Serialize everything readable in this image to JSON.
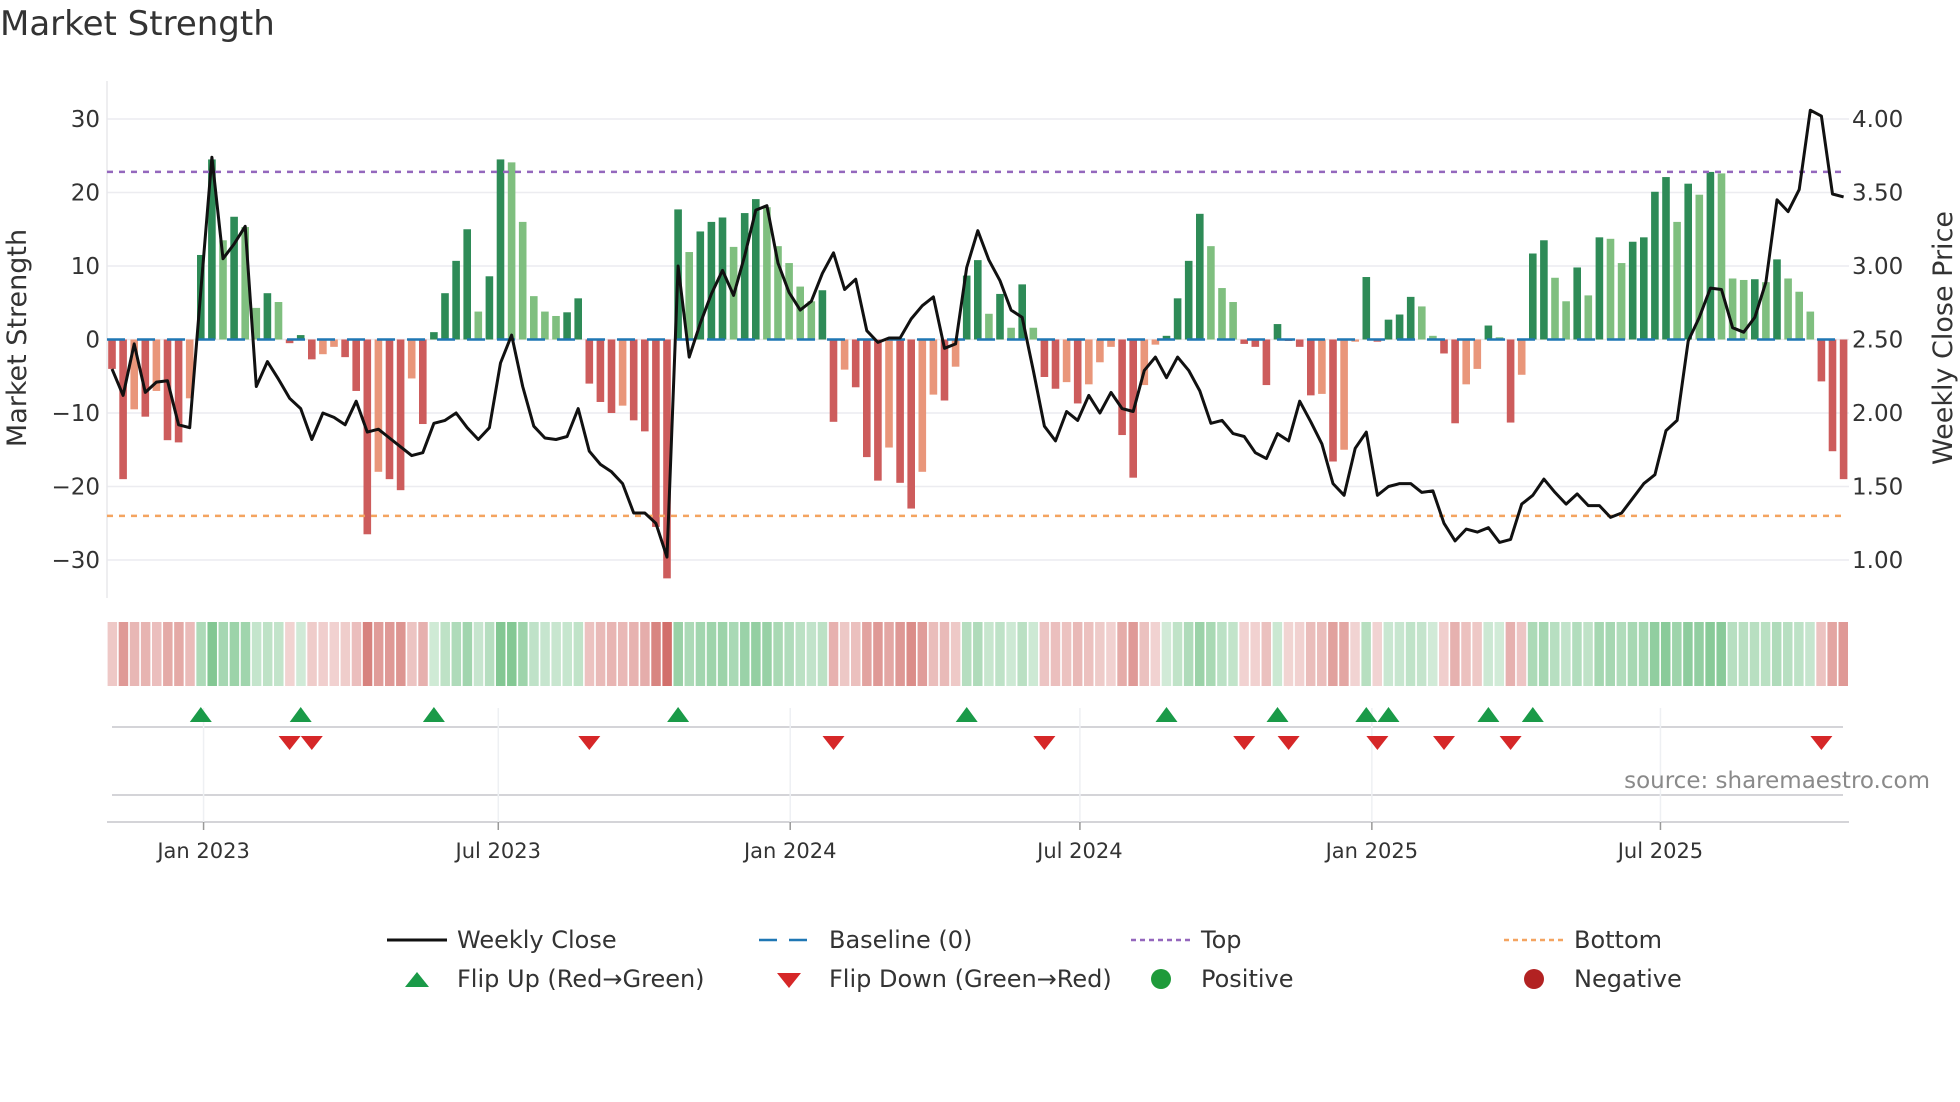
{
  "chart_data": {
    "type": "bar+line",
    "title": "Market Strength",
    "ylabel": "Market Strength",
    "ylabel_right": "Weekly Close Price",
    "ylim": [
      -35,
      35
    ],
    "ylim_right": [
      0.75,
      4.25
    ],
    "yticks": [
      "30",
      "20",
      "10",
      "0",
      "−10",
      "−20",
      "−30"
    ],
    "ytick_values": [
      30,
      20,
      10,
      0,
      -10,
      -20,
      -30
    ],
    "yticks_right": [
      "4.00",
      "3.50",
      "3.00",
      "2.50",
      "2.00",
      "1.50",
      "1.00"
    ],
    "ytick_right_values": [
      4.0,
      3.5,
      3.0,
      2.5,
      2.0,
      1.5,
      1.0
    ],
    "xticks": [
      {
        "label": "Jan 2023",
        "week": 8.25
      },
      {
        "label": "Jul 2023",
        "week": 34.8
      },
      {
        "label": "Jan 2024",
        "week": 61.1
      },
      {
        "label": "Jul 2024",
        "week": 87.2
      },
      {
        "label": "Jan 2025",
        "week": 113.5
      },
      {
        "label": "Jul 2025",
        "week": 139.5
      }
    ],
    "top_level": 22.8,
    "bottom_level": -24,
    "baseline": 0,
    "strength": [
      -4,
      -19,
      -9.5,
      -10.5,
      -7,
      -13.7,
      -14,
      -8,
      11.5,
      24.5,
      13.5,
      16.7,
      15.3,
      4.3,
      6.3,
      5.1,
      -0.5,
      0.6,
      -2.7,
      -2,
      -1,
      -2.4,
      -7,
      -26.5,
      -18,
      -19,
      -20.5,
      -5.3,
      -11.5,
      1,
      6.3,
      10.7,
      15,
      3.8,
      8.6,
      24.5,
      24.1,
      16,
      5.9,
      3.8,
      3.2,
      3.7,
      5.6,
      -6,
      -8.5,
      -10,
      -9,
      -11,
      -12.5,
      -25.5,
      -32.5,
      17.7,
      11.9,
      14.7,
      16,
      16.6,
      12.6,
      17.2,
      19.1,
      18,
      12.7,
      10.4,
      7.2,
      5.2,
      6.7,
      -11.2,
      -4.1,
      -6.5,
      -16,
      -19.2,
      -14.7,
      -19.5,
      -23,
      -18,
      -7.5,
      -8.3,
      -3.7,
      8.7,
      10.8,
      3.5,
      6.2,
      1.6,
      7.5,
      1.6,
      -5.1,
      -6.7,
      -5.8,
      -8.7,
      -6.1,
      -3.1,
      -1,
      -13,
      -18.8,
      -6.2,
      -0.7,
      0.5,
      5.6,
      10.7,
      17.1,
      12.7,
      7,
      5.1,
      -0.6,
      -1,
      -6.2,
      2.1,
      -0.2,
      -1,
      -7.6,
      -7.4,
      -16.6,
      -15,
      -0.3,
      8.5,
      -0.3,
      2.7,
      3.4,
      5.8,
      4.5,
      0.5,
      -1.9,
      -11.4,
      -6.1,
      -4,
      1.9,
      0.3,
      -11.3,
      -4.8,
      11.7,
      13.5,
      8.4,
      5.2,
      9.8,
      6,
      13.9,
      13.7,
      10.4,
      13.3,
      13.9,
      20.1,
      22.1,
      16,
      21.2,
      19.7,
      22.8,
      22.6,
      8.3,
      8.1,
      8.2,
      7.8,
      10.9,
      8.3,
      6.5,
      3.8,
      -5.7,
      -15.2,
      -19
    ],
    "weekly_close": [
      2.3,
      2.12,
      2.47,
      2.14,
      2.21,
      2.22,
      1.92,
      1.9,
      2.83,
      3.74,
      3.05,
      3.15,
      3.27,
      2.18,
      2.35,
      2.23,
      2.1,
      2.03,
      1.82,
      2.0,
      1.97,
      1.92,
      2.08,
      1.87,
      1.89,
      1.83,
      1.77,
      1.71,
      1.73,
      1.93,
      1.95,
      2.0,
      1.9,
      1.82,
      1.9,
      2.34,
      2.53,
      2.18,
      1.91,
      1.83,
      1.82,
      1.84,
      2.03,
      1.74,
      1.65,
      1.6,
      1.52,
      1.32,
      1.32,
      1.25,
      1.02,
      3.0,
      2.38,
      2.61,
      2.81,
      2.97,
      2.8,
      3.07,
      3.38,
      3.41,
      3.02,
      2.82,
      2.7,
      2.76,
      2.95,
      3.09,
      2.84,
      2.91,
      2.56,
      2.48,
      2.51,
      2.51,
      2.64,
      2.73,
      2.79,
      2.44,
      2.47,
      2.99,
      3.24,
      3.04,
      2.9,
      2.7,
      2.65,
      2.29,
      1.91,
      1.81,
      2.01,
      1.95,
      2.12,
      2.0,
      2.14,
      2.03,
      2.01,
      2.29,
      2.38,
      2.24,
      2.38,
      2.29,
      2.15,
      1.93,
      1.95,
      1.86,
      1.84,
      1.73,
      1.69,
      1.86,
      1.81,
      2.08,
      1.94,
      1.79,
      1.52,
      1.44,
      1.76,
      1.87,
      1.44,
      1.5,
      1.52,
      1.52,
      1.46,
      1.47,
      1.25,
      1.13,
      1.21,
      1.19,
      1.22,
      1.12,
      1.14,
      1.38,
      1.44,
      1.55,
      1.46,
      1.38,
      1.45,
      1.37,
      1.37,
      1.29,
      1.32,
      1.42,
      1.52,
      1.58,
      1.88,
      1.95,
      2.49,
      2.65,
      2.85,
      2.84,
      2.58,
      2.55,
      2.65,
      2.89,
      3.45,
      3.37,
      3.52,
      4.06,
      4.02,
      3.49,
      3.47
    ],
    "grid": true,
    "legend_placement": "bottom-center",
    "legend": [
      {
        "label": "Weekly Close",
        "icon": "line-icon"
      },
      {
        "label": "Baseline (0)",
        "icon": "dashed-line-icon"
      },
      {
        "label": "Top",
        "icon": "dotted-line-icon"
      },
      {
        "label": "Bottom",
        "icon": "dotted-line-icon"
      },
      {
        "label": "Flip Up (Red→Green)",
        "icon": "triangle-up-icon"
      },
      {
        "label": "Flip Down (Green→Red)",
        "icon": "triangle-down-icon"
      },
      {
        "label": "Positive",
        "icon": "circle-icon"
      },
      {
        "label": "Negative",
        "icon": "circle-icon"
      }
    ],
    "source": "source: sharemaestro.com"
  },
  "colors": {
    "strong_up": "#2e8b57",
    "weak_up": "#7fbf7f",
    "strong_down": "#cd5c5c",
    "weak_down": "#e9967a",
    "line": "#111111",
    "baseline": "#1f77b4",
    "top": "#9467bd",
    "bottom": "#f4a460",
    "flip_up": "#1a9a48",
    "flip_down": "#d62728",
    "positive": "#1e9a3a",
    "negative": "#b22222"
  }
}
